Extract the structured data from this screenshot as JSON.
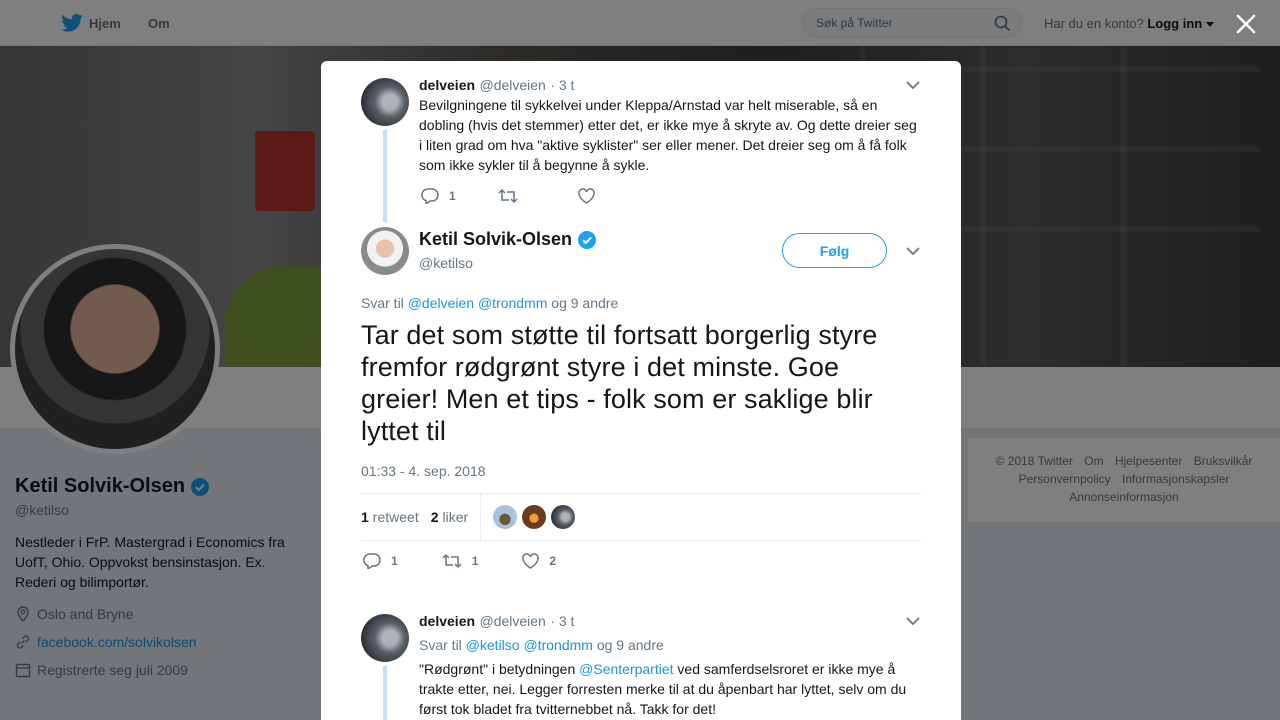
{
  "topbar": {
    "home_label": "Hjem",
    "about_label": "Om",
    "search_placeholder": "Søk på Twitter",
    "account_prompt": "Har du en konto?",
    "login_label": "Logg inn"
  },
  "profile": {
    "name": "Ketil Solvik-Olsen",
    "handle": "@ketilso",
    "bio": "Nestleder i FrP. Mastergrad i Economics fra UofT, Ohio. Oppvokst bensinstasjon. Ex. Rederi og bilimportør.",
    "location": "Oslo and Bryne",
    "website": "facebook.com/solvikolsen",
    "joined": "Registrerte seg juli 2009"
  },
  "footer": {
    "links": [
      "© 2018 Twitter",
      "Om",
      "Hjelpesenter",
      "Bruksvilkår",
      "Personvernpolicy",
      "Informasjonskapsler",
      "Annonseinformasjon"
    ]
  },
  "modal": {
    "parent_tweet": {
      "name": "delveien",
      "handle": "@delveien",
      "time": "· 3 t",
      "text": "Bevilgningene til sykkelvei under Kleppa/Arnstad var helt miserable, så en dobling (hvis det stemmer) etter det, er ikke mye å skryte av. Og dette dreier seg i liten grad om hva \"aktive syklister\" ser eller mener. Det dreier seg om å få folk som ikke sykler til å begynne å sykle.",
      "reply_count": "1"
    },
    "main_tweet": {
      "name": "Ketil Solvik-Olsen",
      "handle": "@ketilso",
      "follow_label": "Følg",
      "reply_prefix": "Svar til",
      "reply_user1": "@delveien",
      "reply_user2": "@trondmm",
      "reply_suffix": "og 9 andre",
      "text": "Tar det som støtte til fortsatt borgerlig styre fremfor rødgrønt styre i det minste. Goe greier! Men et tips - folk som er saklige blir lyttet til",
      "timestamp": "01:33 - 4. sep. 2018",
      "retweet_count": "1",
      "retweet_label": "retweet",
      "like_count": "2",
      "like_label": "liker",
      "action_reply": "1",
      "action_retweet": "1",
      "action_like": "2"
    },
    "reply_tweet": {
      "name": "delveien",
      "handle": "@delveien",
      "time": "· 3 t",
      "reply_prefix": "Svar til",
      "reply_user1": "@ketilso",
      "reply_user2": "@trondmm",
      "reply_suffix": "og 9 andre",
      "text_before": "\"Rødgrønt\" i betydningen",
      "mention": "@Senterpartiet",
      "text_after": "ved samferdselsroret er ikke mye å trakte etter, nei. Legger forresten merke til at du åpenbart har lyttet, selv om du først tok bladet fra tvitternebbet nå. Takk for det!"
    }
  },
  "colors": {
    "twitter_blue": "#1da1f2",
    "link_blue": "#1b95e0",
    "verified_blue": "#1da1f2",
    "thread_line": "#c4e3f4"
  }
}
